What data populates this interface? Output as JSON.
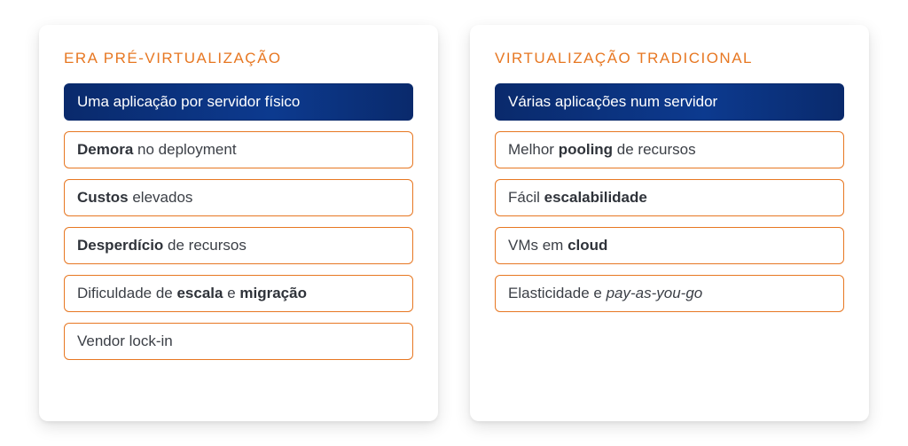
{
  "columns": [
    {
      "title": "ERA PRÉ-VIRTUALIZAÇÃO",
      "items": [
        {
          "html": "Uma aplicação por servidor físico",
          "primary": true
        },
        {
          "html": "<b>Demora</b> no deployment"
        },
        {
          "html": "<b>Custos</b> elevados"
        },
        {
          "html": "<b>Desperdício</b> de recursos"
        },
        {
          "html": "Dificuldade de <b>escala</b> e <b>migração</b>"
        },
        {
          "html": "Vendor lock-in"
        }
      ]
    },
    {
      "title": "VIRTUALIZAÇÃO TRADICIONAL",
      "items": [
        {
          "html": "Várias aplicações num servidor",
          "primary": true
        },
        {
          "html": "Melhor <b>pooling</b> de recursos"
        },
        {
          "html": "Fácil <b>escalabilidade</b>"
        },
        {
          "html": "VMs em <b>cloud</b>"
        },
        {
          "html": "Elasticidade e <i>pay-as-you-go</i>"
        }
      ]
    }
  ]
}
